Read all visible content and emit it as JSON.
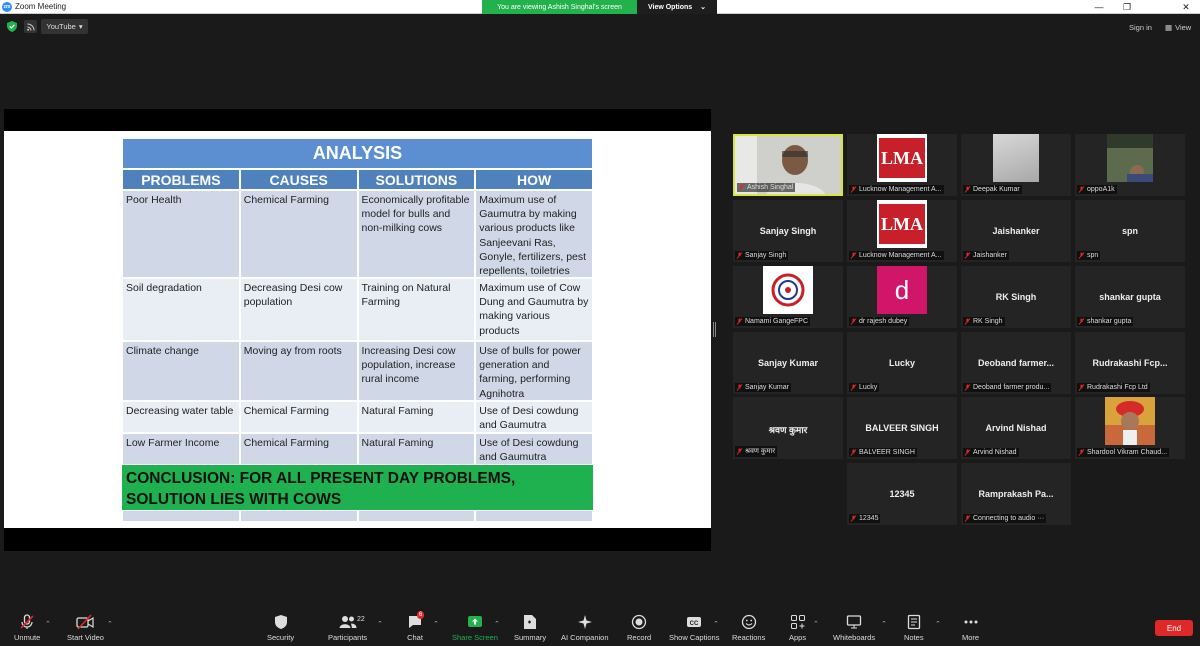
{
  "window": {
    "title": "Zoom Meeting"
  },
  "share_banner": {
    "text": "You are viewing Ashish Singhal's screen",
    "options_label": "View Options"
  },
  "topbar": {
    "stream_label": "YouTube",
    "signin_label": "Sign in",
    "view_label": "View"
  },
  "slide": {
    "title": "ANALYSIS",
    "headers": [
      "PROBLEMS",
      "CAUSES",
      "SOLUTIONS",
      "HOW"
    ],
    "rows": [
      {
        "problem": "Poor Health",
        "cause": "Chemical Farming",
        "solution": "Economically profitable model for bulls and non-milking cows",
        "how": "Maximum use of Gaumutra by making various products like Sanjeevani Ras, Gonyle, fertilizers, pest repellents, toiletries"
      },
      {
        "problem": "Soil degradation",
        "cause": "Decreasing Desi cow population",
        "solution": "Training on Natural Farming",
        "how": "Maximum use of Cow Dung and Gaumutra by making various products"
      },
      {
        "problem": "Climate change",
        "cause": "Moving ay from roots",
        "solution": "Increasing Desi cow population, increase rural income",
        "how": "Use of bulls for power generation and farming, performing Agnihotra"
      },
      {
        "problem": "Decreasing water table",
        "cause": "Chemical Farming",
        "solution": "Natural Faming",
        "how": "Use of Desi cowdung and Gaumutra"
      },
      {
        "problem": "Low Farmer Income",
        "cause": "Chemical Farming",
        "solution": "Natural Faming",
        "how": "Use of Desi cowdung and Gaumutra"
      }
    ],
    "conclusion": "CONCLUSION: FOR ALL PRESENT DAY PROBLEMS, SOLUTION LIES WITH COWS"
  },
  "participants": [
    {
      "name": "",
      "label": "Ashish Singhal",
      "kind": "video"
    },
    {
      "name": "",
      "label": "Lucknow Management A...",
      "kind": "lma"
    },
    {
      "name": "",
      "label": "Deepak Kumar",
      "kind": "photo-grey"
    },
    {
      "name": "",
      "label": "oppoA1k",
      "kind": "photo-person"
    },
    {
      "name": "Sanjay Singh",
      "label": "Sanjay Singh",
      "kind": "text"
    },
    {
      "name": "",
      "label": "Lucknow Management A...",
      "kind": "lma"
    },
    {
      "name": "Jaishanker",
      "label": "Jaishanker",
      "kind": "text"
    },
    {
      "name": "spn",
      "label": "spn",
      "kind": "text"
    },
    {
      "name": "",
      "label": "Namami GangeFPC",
      "kind": "logo-circle"
    },
    {
      "name": "",
      "label": "dr rajesh dubey",
      "kind": "letter-d"
    },
    {
      "name": "RK Singh",
      "label": "RK Singh",
      "kind": "text"
    },
    {
      "name": "shankar gupta",
      "label": "shankar gupta",
      "kind": "text"
    },
    {
      "name": "Sanjay Kumar",
      "label": "Sanjay Kumar",
      "kind": "text"
    },
    {
      "name": "Lucky",
      "label": "Lucky",
      "kind": "text"
    },
    {
      "name": "Deoband  farmer...",
      "label": "Deoband farmer produ...",
      "kind": "text"
    },
    {
      "name": "Rudrakashi  Fcp...",
      "label": "Rudrakashi Fcp Ltd",
      "kind": "text"
    },
    {
      "name": "श्रवण कुमार",
      "label": "श्रवण कुमार",
      "kind": "text"
    },
    {
      "name": "BALVEER SINGH",
      "label": "BALVEER SINGH",
      "kind": "text"
    },
    {
      "name": "Arvind Nishad",
      "label": "Arvind Nishad",
      "kind": "text"
    },
    {
      "name": "",
      "label": "Shardool Vikram Chaud...",
      "kind": "photo-turban"
    },
    {
      "name": "12345",
      "label": "12345",
      "kind": "text"
    },
    {
      "name": "Ramprakash  Pa...",
      "label": "Connecting to audio ···",
      "kind": "text"
    }
  ],
  "lma_text": "LMA",
  "letter_d": "d",
  "toolbar": {
    "unmute": "Unmute",
    "start_video": "Start Video",
    "security": "Security",
    "participants": "Participants",
    "participants_count": "22",
    "chat": "Chat",
    "chat_badge": "6",
    "share_screen": "Share Screen",
    "summary": "Summary",
    "ai_companion": "AI Companion",
    "record": "Record",
    "show_captions": "Show Captions",
    "reactions": "Reactions",
    "apps": "Apps",
    "whiteboards": "Whiteboards",
    "notes": "Notes",
    "more": "More",
    "end": "End"
  },
  "colors": {
    "accent_green": "#22b14c",
    "end_red": "#e02828",
    "table_header": "#4f81bd",
    "conclusion_green": "#1fb050",
    "active_speaker": "#d6e63a"
  }
}
